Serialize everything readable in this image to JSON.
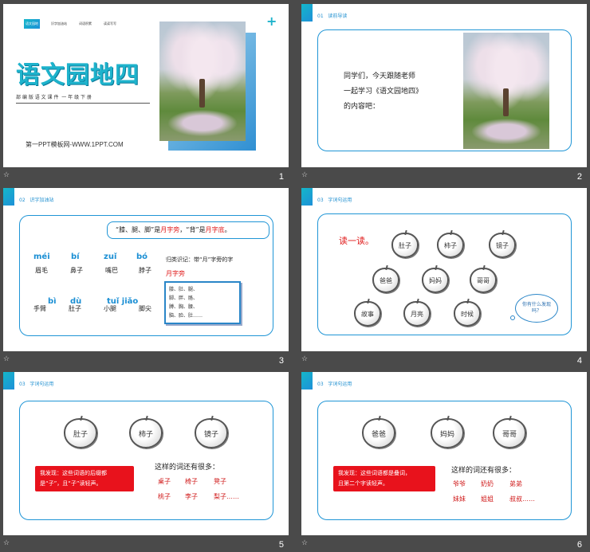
{
  "slide1": {
    "tab_labels": [
      "语文园地",
      "识字加油站",
      "词语积累",
      "读读写写"
    ],
    "title": "语文园地四",
    "subtitle": "部 编 版 语 文 课 件  一 年 级 下 册",
    "footer": "第一PPT模板网-WWW.1PPT.COM",
    "plus": "+",
    "number": "1"
  },
  "slide2": {
    "section": "01   读前导读",
    "text_lines": [
      "同学们，今天跟随老师",
      "一起学习《语文园地四》",
      "的内容吧："
    ],
    "number": "2"
  },
  "slide3": {
    "section": "02   识字加油站",
    "bubble_parts": [
      "“膝、腿、脚”是",
      "月字旁",
      "，“背”是",
      "月字底",
      "。"
    ],
    "row1": [
      {
        "pinyin": "méi",
        "hanzi": "眉毛"
      },
      {
        "pinyin": "bí",
        "hanzi": "鼻子"
      },
      {
        "pinyin": "zuǐ",
        "hanzi": "嘴巴"
      },
      {
        "pinyin": "bó",
        "hanzi": "脖子"
      }
    ],
    "row2": [
      {
        "pinyin": "bì",
        "hanzi": "手臂"
      },
      {
        "pinyin": "dù",
        "hanzi": "肚子"
      },
      {
        "pinyin": "tuǐ jiǎo",
        "hanzi": "小腿"
      },
      {
        "pinyin": "",
        "hanzi": "脚尖"
      }
    ],
    "note_label": "归类识记：带“月”字旁的字",
    "note_red": "月字旁",
    "char_box_lines": [
      "膝、肚、腿、",
      "脚、胖、胳、",
      "膊、胸、腰、",
      "脑、脸、肚……"
    ],
    "number": "3"
  },
  "slide4": {
    "section": "03   字词句运用",
    "read_label": "读一读。",
    "apples": [
      "肚子",
      "柿子",
      "镜子",
      "爸爸",
      "妈妈",
      "哥哥",
      "故事",
      "月亮",
      "时候"
    ],
    "cloud_text": "你有什么发现吗？",
    "number": "4"
  },
  "slide5": {
    "section": "03   字词句运用",
    "apples": [
      "肚子",
      "柿子",
      "镜子"
    ],
    "red_box": [
      "我发现：这些词语的后缀都",
      "是“子”，且“子”读轻声。"
    ],
    "heading": "这样的词还有很多：",
    "words": [
      [
        "桌子",
        "椅子",
        "凳子"
      ],
      [
        "桃子",
        "李子",
        "梨子……"
      ]
    ],
    "number": "5"
  },
  "slide6": {
    "section": "03   字词句运用",
    "apples": [
      "爸爸",
      "妈妈",
      "哥哥"
    ],
    "red_box": [
      "我发现：这些词语都是叠词，",
      "且第二个字读轻声。"
    ],
    "heading": "这样的词还有很多：",
    "words": [
      [
        "爷爷",
        "奶奶",
        "弟弟"
      ],
      [
        "妹妹",
        "姐姐",
        "叔叔……"
      ]
    ],
    "number": "6"
  },
  "star_glyph": "☆"
}
